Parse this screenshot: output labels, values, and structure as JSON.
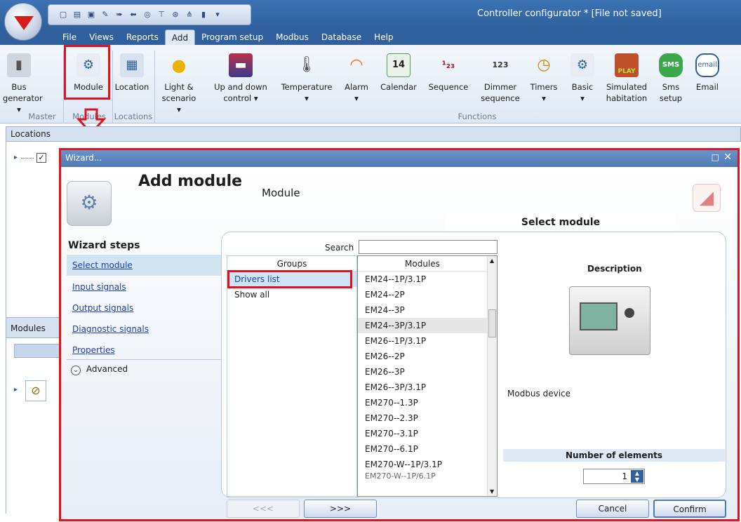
{
  "app": {
    "title": "Controller configurator * [File not saved]"
  },
  "menu": {
    "items": [
      "File",
      "Views",
      "Reports",
      "Add",
      "Program setup",
      "Modbus",
      "Database",
      "Help"
    ],
    "active": "Add"
  },
  "ribbon": {
    "buttons": [
      {
        "label": "Bus",
        "label2": "generator ▾",
        "icon": "bus-generator-icon"
      },
      {
        "label": "Module",
        "label2": "",
        "icon": "module-icon"
      },
      {
        "label": "Location",
        "label2": "",
        "icon": "building-icon"
      },
      {
        "label": "Light &",
        "label2": "scenario ▾",
        "icon": "lightbulb-icon"
      },
      {
        "label": "Up and down",
        "label2": "control ▾",
        "icon": "blind-icon"
      },
      {
        "label": "Temperature",
        "label2": "▾",
        "icon": "thermometer-icon"
      },
      {
        "label": "Alarm",
        "label2": "▾",
        "icon": "alarm-icon"
      },
      {
        "label": "Calendar",
        "label2": "",
        "icon": "calendar-icon",
        "badge": "14"
      },
      {
        "label": "Sequence",
        "label2": "",
        "icon": "sequence-icon"
      },
      {
        "label": "Dimmer",
        "label2": "sequence",
        "icon": "dimmer-icon",
        "badge": "123"
      },
      {
        "label": "Timers",
        "label2": "▾",
        "icon": "timer-icon"
      },
      {
        "label": "Basic",
        "label2": "▾",
        "icon": "basic-module-icon"
      },
      {
        "label": "Simulated",
        "label2": "habitation",
        "icon": "house-icon",
        "badge": "PLAY"
      },
      {
        "label": "Sms",
        "label2": "setup",
        "icon": "sms-icon",
        "badge": "SMS"
      },
      {
        "label": "Email",
        "label2": "",
        "icon": "email-icon",
        "badge": "email"
      }
    ],
    "groups": [
      "Master",
      "Modules",
      "Locations",
      "Functions"
    ]
  },
  "panels": {
    "locations": "Locations",
    "modules": "Modules"
  },
  "wizard": {
    "window_title": "Wizard...",
    "heading": "Add module",
    "subheading": "Module",
    "section_title": "Select module",
    "steps_title": "Wizard steps",
    "steps": [
      "Select module",
      "Input signals",
      "Output signals",
      "Diagnostic signals",
      "Properties"
    ],
    "advanced": "Advanced",
    "search_label": "Search",
    "search_value": "",
    "groups_header": "Groups",
    "groups": [
      "Drivers list",
      "Show all"
    ],
    "modules_header": "Modules",
    "modules": [
      "EM24--1P/3.1P",
      "EM24--2P",
      "EM24--3P",
      "EM24--3P/3.1P",
      "EM26--1P/3.1P",
      "EM26--2P",
      "EM26--3P",
      "EM26--3P/3.1P",
      "EM270--1.3P",
      "EM270--2.3P",
      "EM270--3.1P",
      "EM270--6.1P",
      "EM270-W--1P/3.1P",
      "EM270-W--1P/6.1P"
    ],
    "selected_module": "EM24--3P/3.1P",
    "description_title": "Description",
    "description_text": "Modbus device",
    "number_label": "Number of elements",
    "number_value": "1",
    "prev_button": "<<<",
    "next_button": ">>>",
    "cancel_button": "Cancel",
    "confirm_button": "Confirm"
  }
}
